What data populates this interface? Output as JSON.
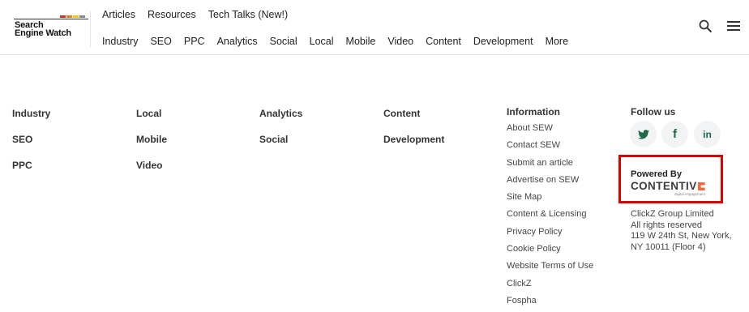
{
  "logo": {
    "line1": "Search",
    "line2": "Engine Watch",
    "bar_colors": [
      "#c0392b",
      "#e67e22",
      "#f1c40f",
      "#7f8c8d"
    ]
  },
  "top_nav": [
    "Articles",
    "Resources",
    "Tech Talks (New!)"
  ],
  "main_nav": [
    "Industry",
    "SEO",
    "PPC",
    "Analytics",
    "Social",
    "Local",
    "Mobile",
    "Video",
    "Content",
    "Development",
    "More"
  ],
  "icons": {
    "search": "search-icon",
    "menu": "hamburger-menu-icon"
  },
  "footer": {
    "columns": [
      [
        "Industry",
        "SEO",
        "PPC"
      ],
      [
        "Local",
        "Mobile",
        "Video"
      ],
      [
        "Analytics",
        "Social"
      ],
      [
        "Content",
        "Development"
      ]
    ],
    "information": {
      "title": "Information",
      "links": [
        "About SEW",
        "Contact SEW",
        "Submit an article",
        "Advertise on SEW",
        "Site Map",
        "Content & Licensing",
        "Privacy Policy",
        "Cookie Policy",
        "Website Terms of Use",
        "ClickZ",
        "Fospha"
      ]
    },
    "follow": {
      "title": "Follow us",
      "networks": [
        "twitter-icon",
        "facebook-icon",
        "linkedin-icon"
      ]
    },
    "powered_by": {
      "label": "Powered By",
      "brand": "CONTENTIV",
      "tagline": "digital engagement",
      "highlight_color": "#e00000",
      "brand_accent": "#f26b3a"
    },
    "company": {
      "name": "ClickZ Group Limited",
      "rights": "All rights reserved",
      "address_line1": "119 W 24th St, New York,",
      "address_line2": "NY 10011 (Floor 4)"
    }
  },
  "accent_color": "#1e6b45"
}
